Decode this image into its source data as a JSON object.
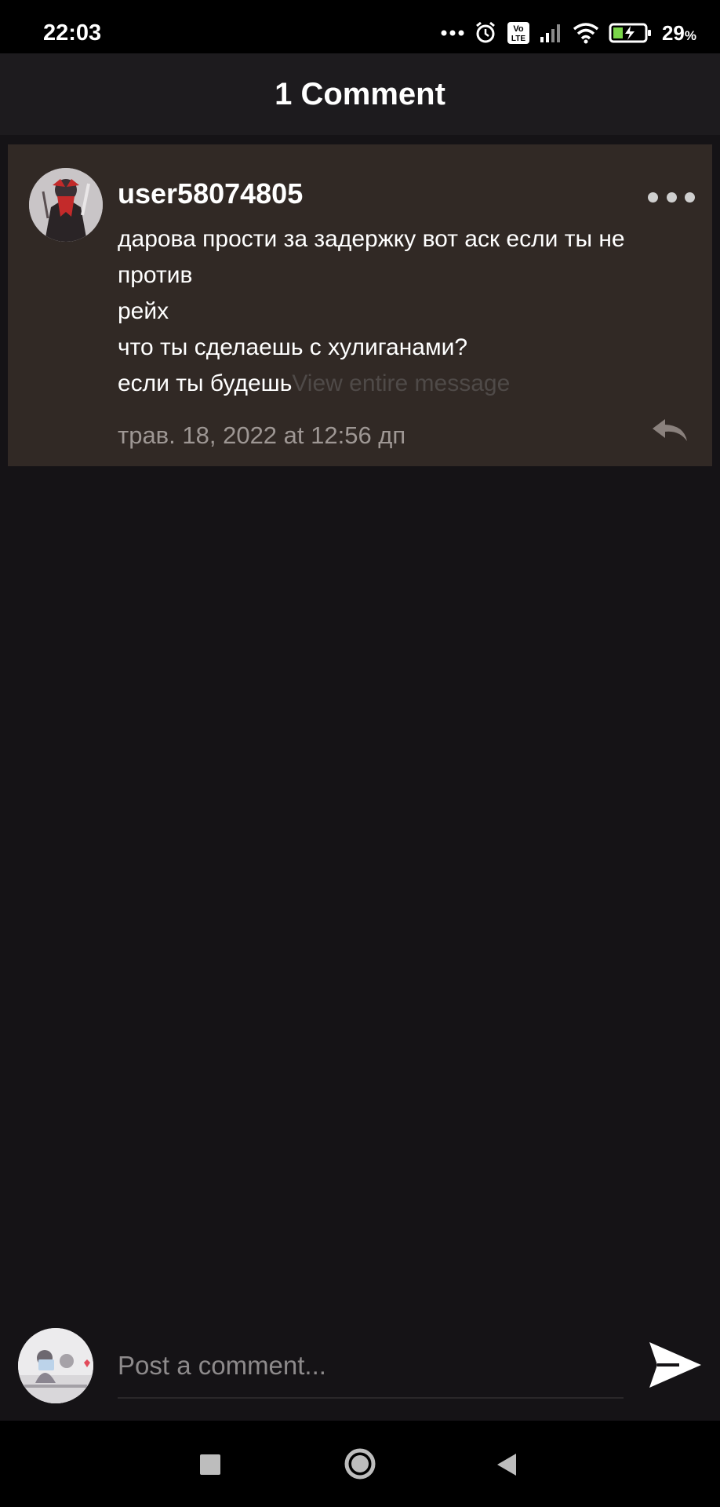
{
  "status_bar": {
    "time": "22:03",
    "battery_percent": "29",
    "battery_unit": "%",
    "network_badge_top": "Vo",
    "network_badge_bottom": "LTE"
  },
  "header": {
    "title": "1 Comment"
  },
  "comment": {
    "username": "user58074805",
    "lines": [
      "дарова прости за задержку вот аск если ты не",
      "против",
      "рейх",
      "что ты сделаешь с хулиганами?",
      "если ты будешь"
    ],
    "view_more": "View entire message",
    "timestamp": "трав. 18, 2022 at 12:56 дп"
  },
  "composer": {
    "placeholder": "Post a comment..."
  },
  "colors": {
    "background": "#151316",
    "card": "#312925",
    "header": "#1d1b1e",
    "muted_text": "#9e9794",
    "view_more_text": "#4f4a48"
  },
  "icons": {
    "status": [
      "more-dots-icon",
      "alarm-icon",
      "volte-icon",
      "signal-icon",
      "wifi-icon",
      "battery-charging-icon"
    ],
    "comment": [
      "more-options-icon",
      "reply-icon"
    ],
    "composer": [
      "send-icon"
    ],
    "nav": [
      "recents-square-icon",
      "home-circle-icon",
      "back-triangle-icon"
    ]
  }
}
